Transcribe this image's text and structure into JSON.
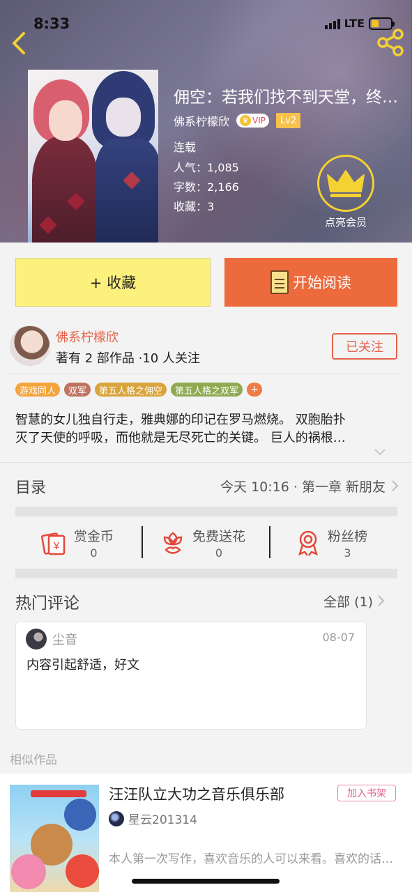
{
  "status": {
    "time": "8:33",
    "network": "LTE"
  },
  "book": {
    "title": "佣空：若我们找不到天堂，终会坠入地狱",
    "author": "佛系柠檬欣",
    "vip": "VIP",
    "level": "Lv2",
    "state": "连载",
    "popularity": "人气：1,085",
    "words": "字数：2,166",
    "favorites": "收藏：3",
    "vip_cta": "点亮会员"
  },
  "actions": {
    "collect": "+ 收藏",
    "read": "开始阅读"
  },
  "author_card": {
    "name": "佛系柠檬欣",
    "stats": "著有 2 部作品 ·10 人关注",
    "follow": "已关注"
  },
  "tags": [
    {
      "label": "游戏同人",
      "color": "#f3a43a"
    },
    {
      "label": "双军",
      "color": "#c07461"
    },
    {
      "label": "第五人格之佣空",
      "color": "#d9a43c"
    },
    {
      "label": "第五人格之双军",
      "color": "#8faa52"
    }
  ],
  "description": {
    "line1": "智慧的女儿独自行走，雅典娜的印记在罗马燃烧。 双胞胎扑",
    "line2": "灭了天使的呼吸，而他就是无尽死亡的关键。 巨人的祸根…"
  },
  "toc": {
    "title": "目录",
    "latest": "今天 10:16 · 第一章 新朋友"
  },
  "stats": [
    {
      "label": "赏金币",
      "value": "0",
      "icon": "reward-envelope-icon"
    },
    {
      "label": "免费送花",
      "value": "0",
      "icon": "flower-icon"
    },
    {
      "label": "粉丝榜",
      "value": "3",
      "icon": "medal-icon"
    }
  ],
  "comments": {
    "title": "热门评论",
    "all": "全部 (1)",
    "items": [
      {
        "user": "尘音",
        "date": "08-07",
        "text": "内容引起舒适，好文"
      }
    ]
  },
  "similar": {
    "label": "相似作品",
    "items": [
      {
        "title": "汪汪队立大功之音乐俱乐部",
        "author": "星云201314",
        "desc": "本人第一次写作，喜欢音乐的人可以来看。喜欢的话请收藏",
        "add": "加入书架"
      }
    ]
  },
  "colors": {
    "accent": "#ec6a3c",
    "collect": "#fcf17c",
    "author": "#e4634a"
  }
}
